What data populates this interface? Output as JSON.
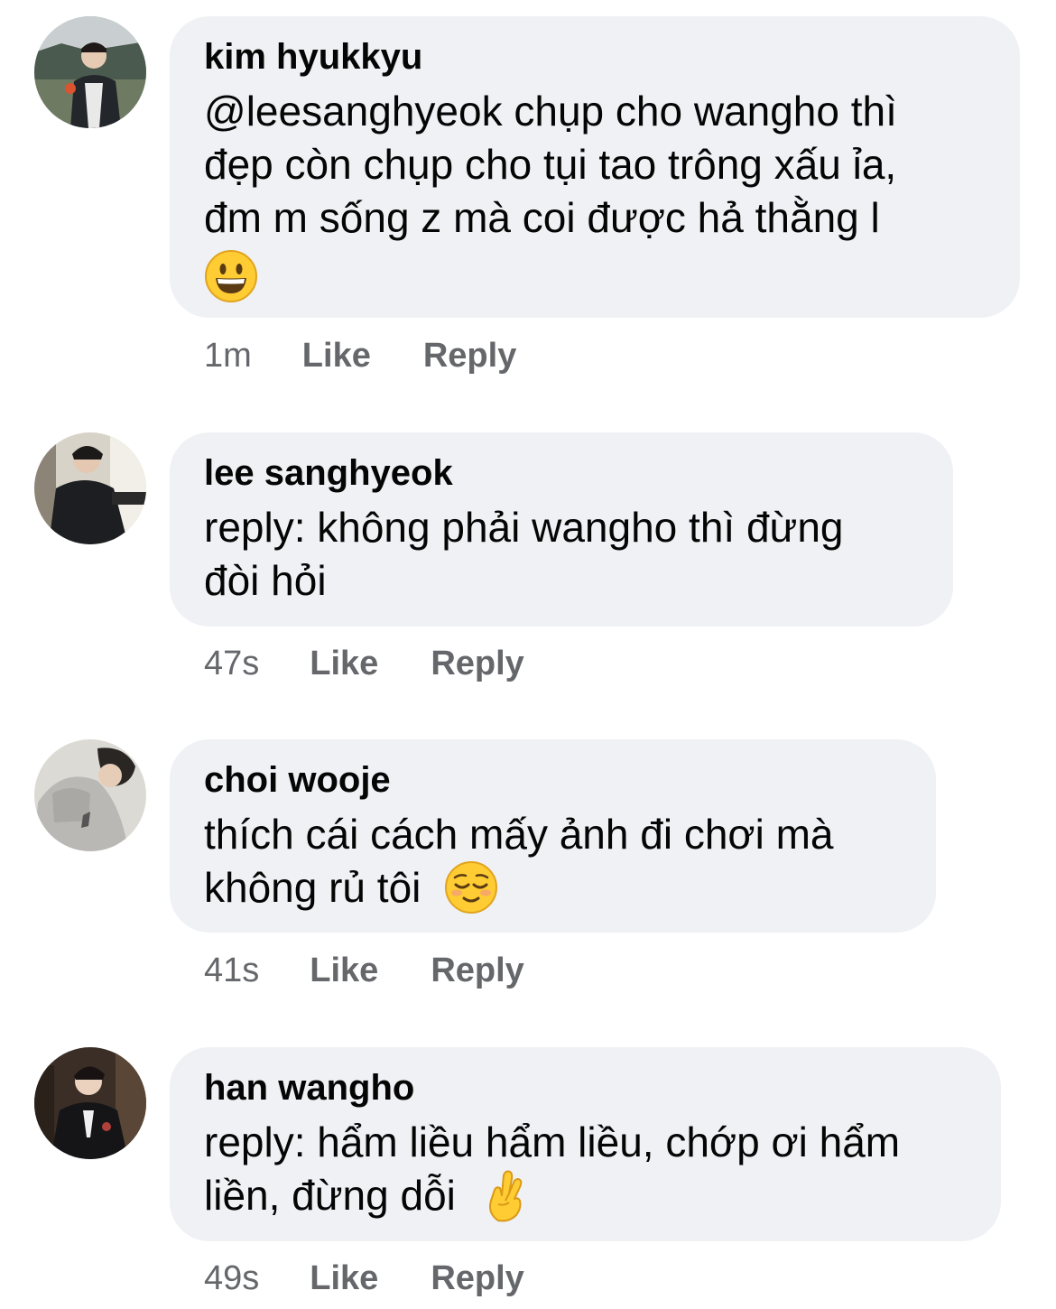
{
  "comments": [
    {
      "author": "kim hyukkyu",
      "lines": [
        "@leesanghyeok chụp cho wangho thì",
        "đẹp còn chụp cho tụi tao trông xấu ỉa,",
        "đm m sống z mà coi được hả thằng l"
      ],
      "emoji": "grinning-face",
      "time": "1m",
      "like_label": "Like",
      "reply_label": "Reply"
    },
    {
      "author": "lee sanghyeok",
      "lines": [
        "reply: không phải wangho thì đừng",
        "đòi hỏi"
      ],
      "emoji": "",
      "time": "47s",
      "like_label": "Like",
      "reply_label": "Reply"
    },
    {
      "author": "choi wooje",
      "lines": [
        "thích cái cách mấy ảnh đi chơi mà",
        "không rủ tôi"
      ],
      "emoji": "relieved-face",
      "time": "41s",
      "like_label": "Like",
      "reply_label": "Reply"
    },
    {
      "author": "han wangho",
      "lines": [
        "reply: hẩm liều hẩm liều, chớp ơi hẩm",
        "liền, đừng dỗi"
      ],
      "emoji": "crossed-fingers",
      "time": "49s",
      "like_label": "Like",
      "reply_label": "Reply"
    }
  ],
  "colors": {
    "bubble": "#f0f1f5",
    "text": "#050505",
    "meta": "#65676b",
    "emoji_yellow": "#ffcc33"
  }
}
